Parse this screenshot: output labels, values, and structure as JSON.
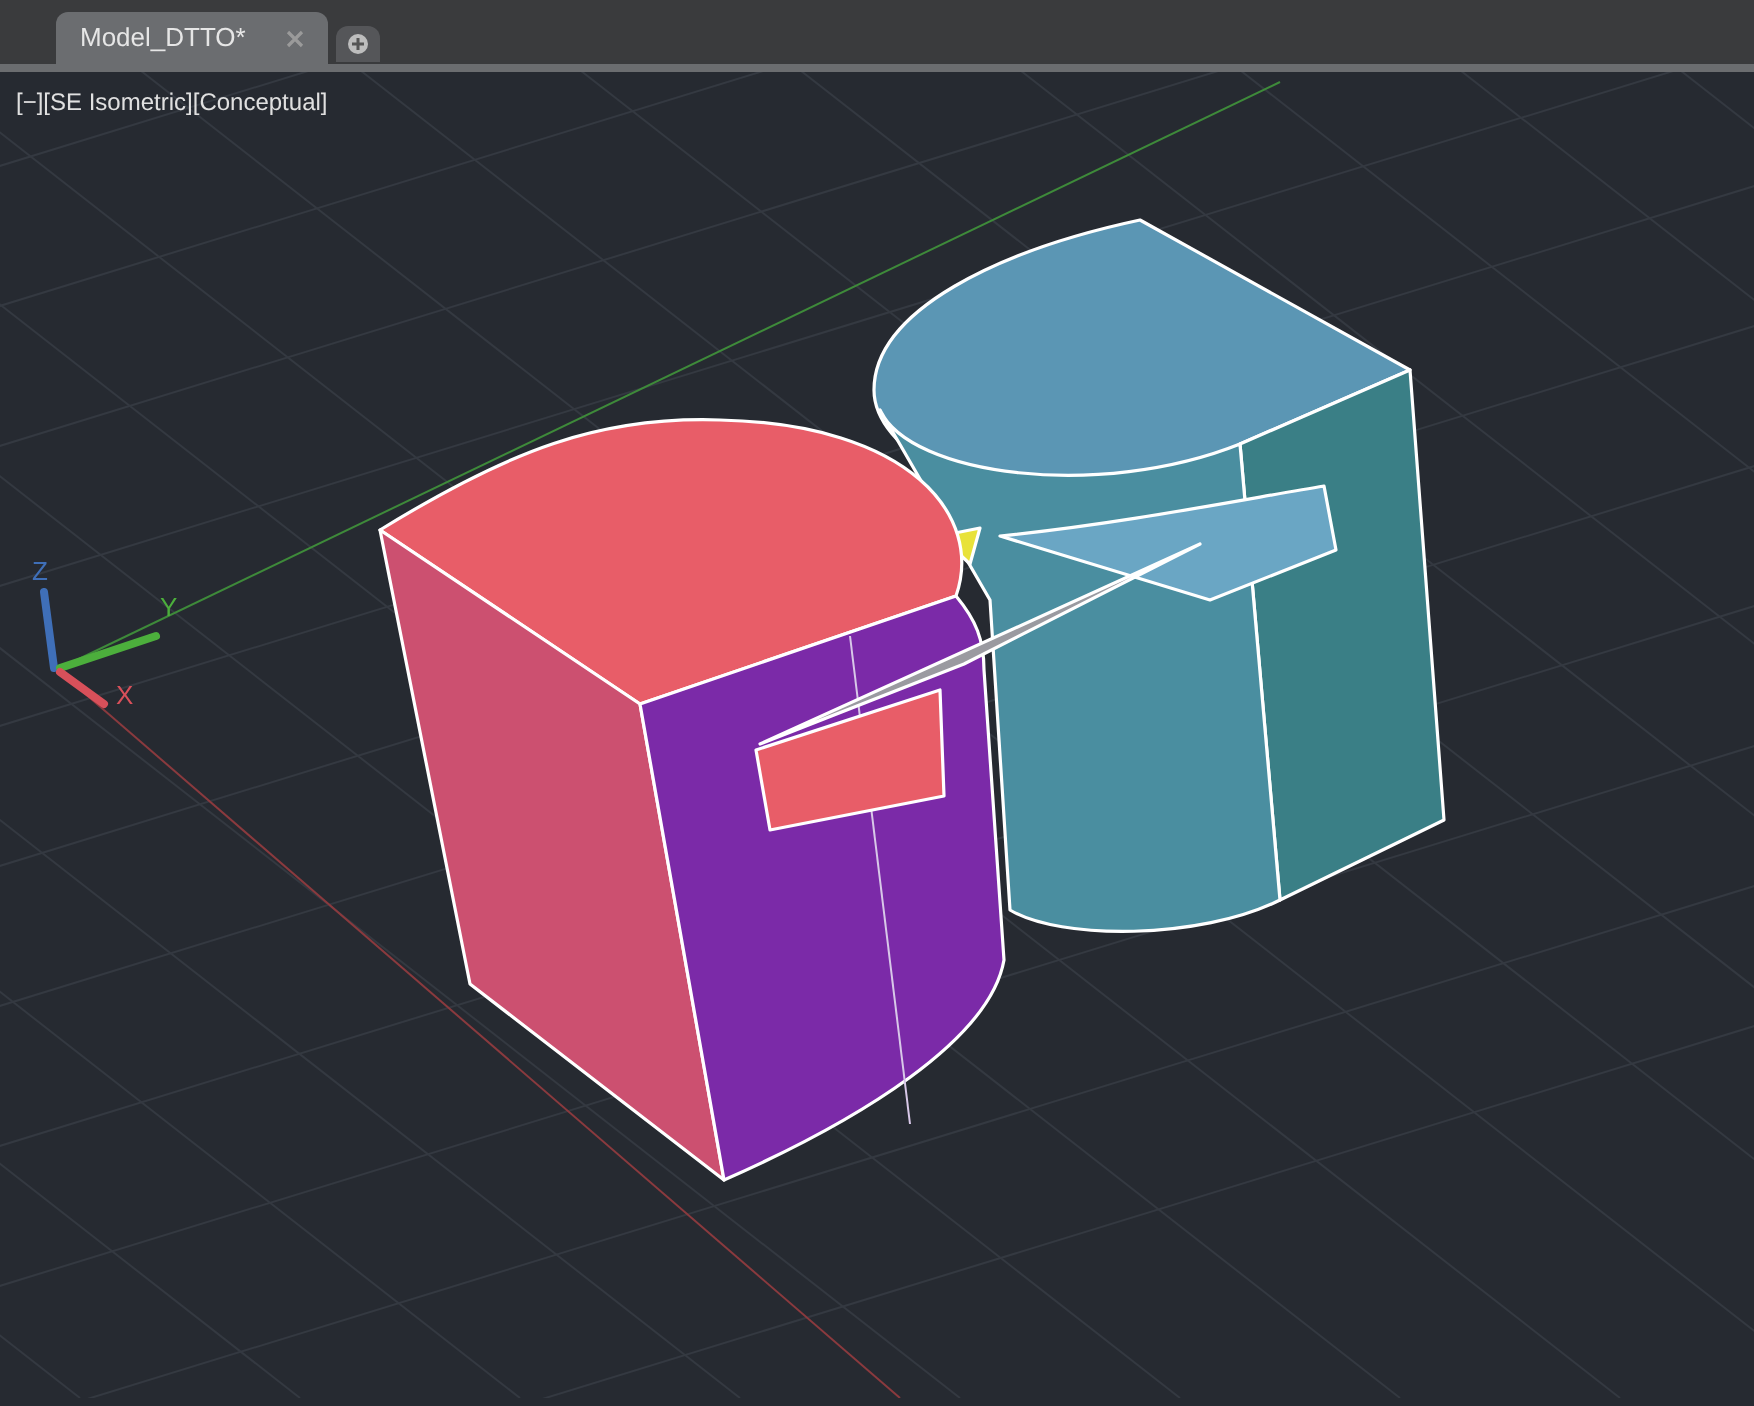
{
  "tabs": [
    {
      "label": "Model_DTTO*",
      "selected": true
    }
  ],
  "viewport": {
    "label": "[−][SE Isometric][Conceptual]",
    "axes": [
      {
        "label": "Z",
        "color": "#3f6fb8"
      },
      {
        "label": "Y",
        "color": "#4caf3c"
      },
      {
        "label": "X",
        "color": "#d8505a"
      }
    ]
  }
}
